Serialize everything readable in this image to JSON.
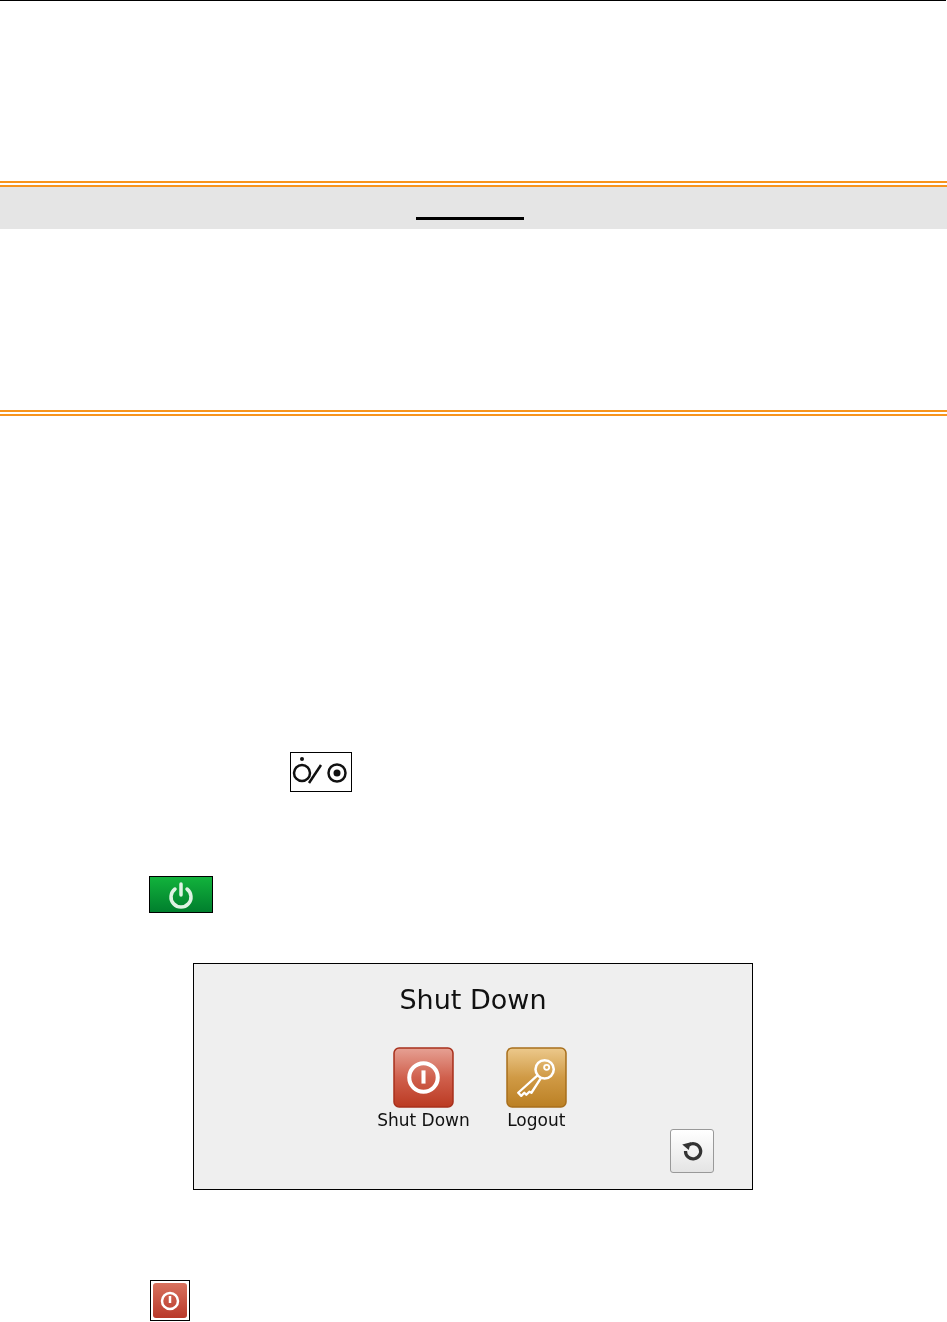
{
  "dialog": {
    "title": "Shut Down",
    "actions": [
      {
        "label": "Shut Down",
        "kind": "shutdown"
      },
      {
        "label": "Logout",
        "kind": "logout"
      }
    ]
  }
}
